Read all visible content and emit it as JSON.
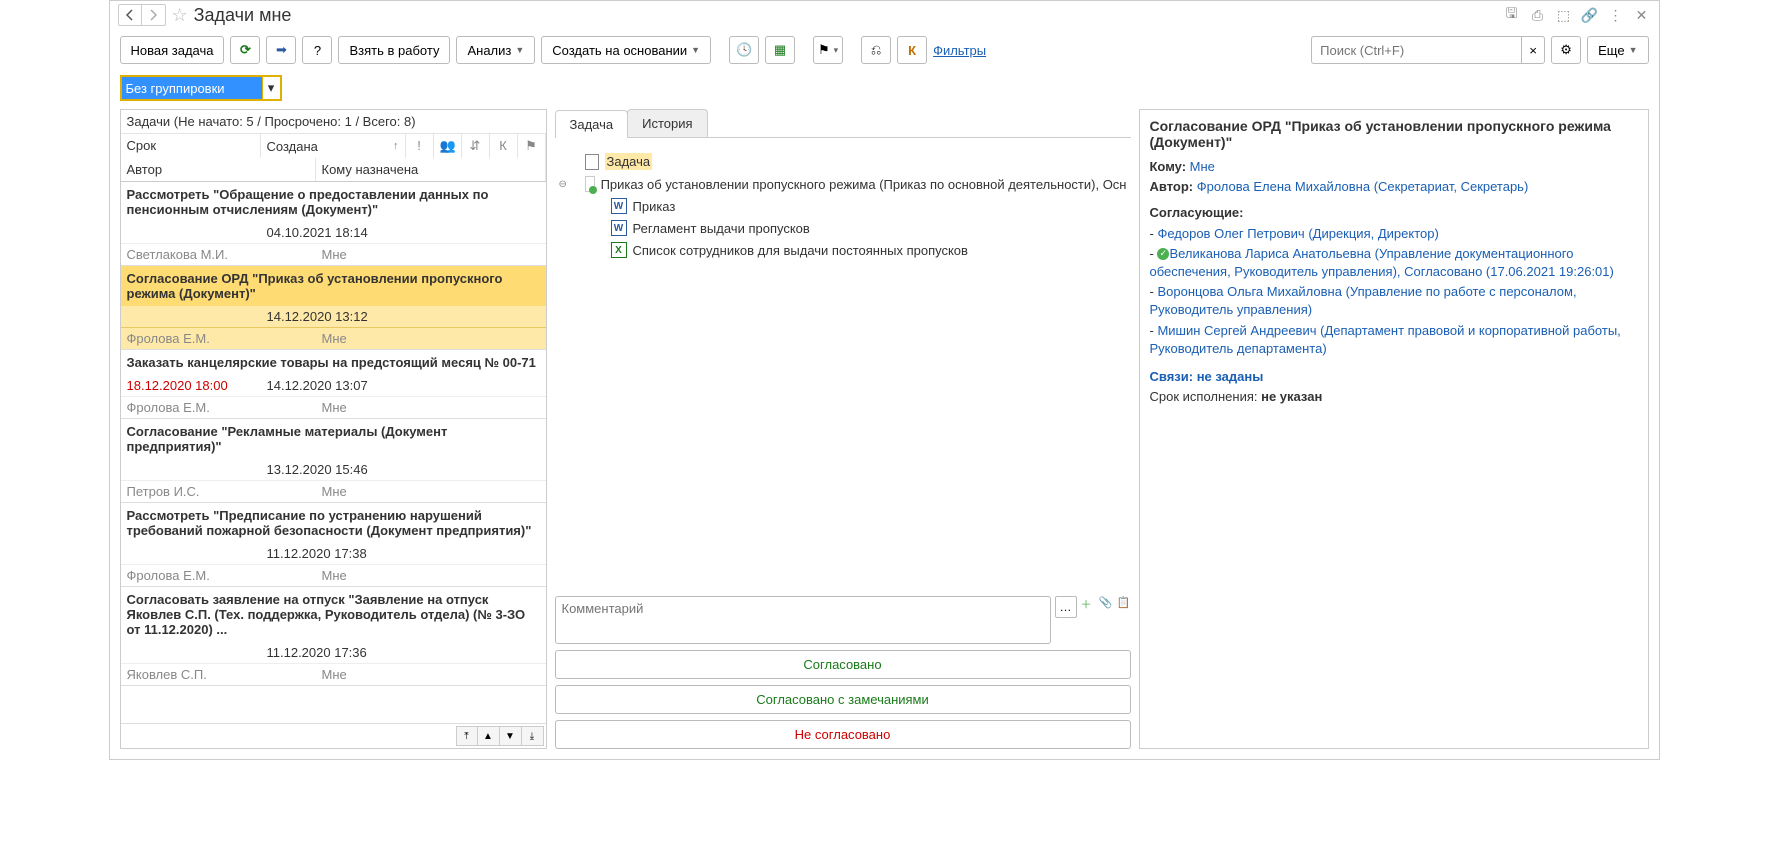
{
  "title": "Задачи мне",
  "toolbar": {
    "new_task": "Новая задача",
    "take_to_work": "Взять в работу",
    "analysis": "Анализ",
    "create_based": "Создать на основании",
    "filters": "Фильтры",
    "search_placeholder": "Поиск (Ctrl+F)",
    "more": "Еще"
  },
  "grouping": {
    "value": "Без группировки"
  },
  "summary": "Задачи (Не начато: 5 / Просрочено: 1 / Всего: 8)",
  "columns": {
    "srok": "Срок",
    "created": "Создана",
    "author": "Автор",
    "assignee": "Кому назначена"
  },
  "tasks": [
    {
      "title": "Рассмотреть \"Обращение о предоставлении данных по пенсионным отчислениям (Документ)\"",
      "due": "",
      "created": "04.10.2021 18:14",
      "author": "Светлакова М.И.",
      "assignee": "Мне",
      "selected": false,
      "overdue": false
    },
    {
      "title": "Согласование ОРД \"Приказ об установлении пропускного режима (Документ)\"",
      "due": "",
      "created": "14.12.2020 13:12",
      "author": "Фролова Е.М.",
      "assignee": "Мне",
      "selected": true,
      "overdue": false
    },
    {
      "title": "Заказать канцелярские товары на предстоящий месяц №  00-71",
      "due": "18.12.2020 18:00",
      "created": "14.12.2020 13:07",
      "author": "Фролова Е.М.",
      "assignee": "Мне",
      "selected": false,
      "overdue": true
    },
    {
      "title": "Согласование \"Рекламные материалы (Документ предприятия)\"",
      "due": "",
      "created": "13.12.2020 15:46",
      "author": "Петров И.С.",
      "assignee": "Мне",
      "selected": false,
      "overdue": false
    },
    {
      "title": "Рассмотреть \"Предписание по устранению нарушений требований пожарной безопасности (Документ предприятия)\"",
      "due": "",
      "created": "11.12.2020 17:38",
      "author": "Фролова Е.М.",
      "assignee": "Мне",
      "selected": false,
      "overdue": false
    },
    {
      "title": "Согласовать заявление на отпуск \"Заявление на отпуск Яковлев С.П. (Тех. поддержка, Руководитель отдела) (№ 3-ЗО от 11.12.2020) ...",
      "due": "",
      "created": "11.12.2020 17:36",
      "author": "Яковлев С.П.",
      "assignee": "Мне",
      "selected": false,
      "overdue": false
    }
  ],
  "tabs": {
    "task": "Задача",
    "history": "История"
  },
  "tree": {
    "root": "Задача",
    "doc": "Приказ об установлении пропускного режима (Приказ по основной деятельности), Осн",
    "att1": "Приказ",
    "att2": "Регламент выдачи пропусков",
    "att3": "Список сотрудников для выдачи постоянных пропусков"
  },
  "comment_placeholder": "Комментарий",
  "actions": {
    "approved": "Согласовано",
    "approved_remarks": "Согласовано с замечаниями",
    "not_approved": "Не согласовано"
  },
  "details": {
    "heading": "Согласование ОРД \"Приказ об установлении пропускного режима (Документ)\"",
    "to_label": "Кому:",
    "to_value": "Мне",
    "author_label": "Автор:",
    "author_value": "Фролова Елена Михайловна (Секретариат, Секретарь)",
    "approvers_label": "Согласующие:",
    "a1": "Федоров Олег Петрович (Дирекция, Директор)",
    "a2_name": "Великанова Лариса Анатольевна (Управление документационного обеспечения, Руководитель управления)",
    "a2_status": ", Согласовано (17.06.2021 19:26:01)",
    "a3": "Воронцова Ольга Михайловна (Управление по работе с персоналом, Руководитель управления)",
    "a4": "Мишин Сергей Андреевич (Департамент правовой и корпоративной работы, Руководитель департамента)",
    "links": "Связи: не заданы",
    "deadline_label": "Срок исполнения:",
    "deadline_value": "не указан"
  }
}
